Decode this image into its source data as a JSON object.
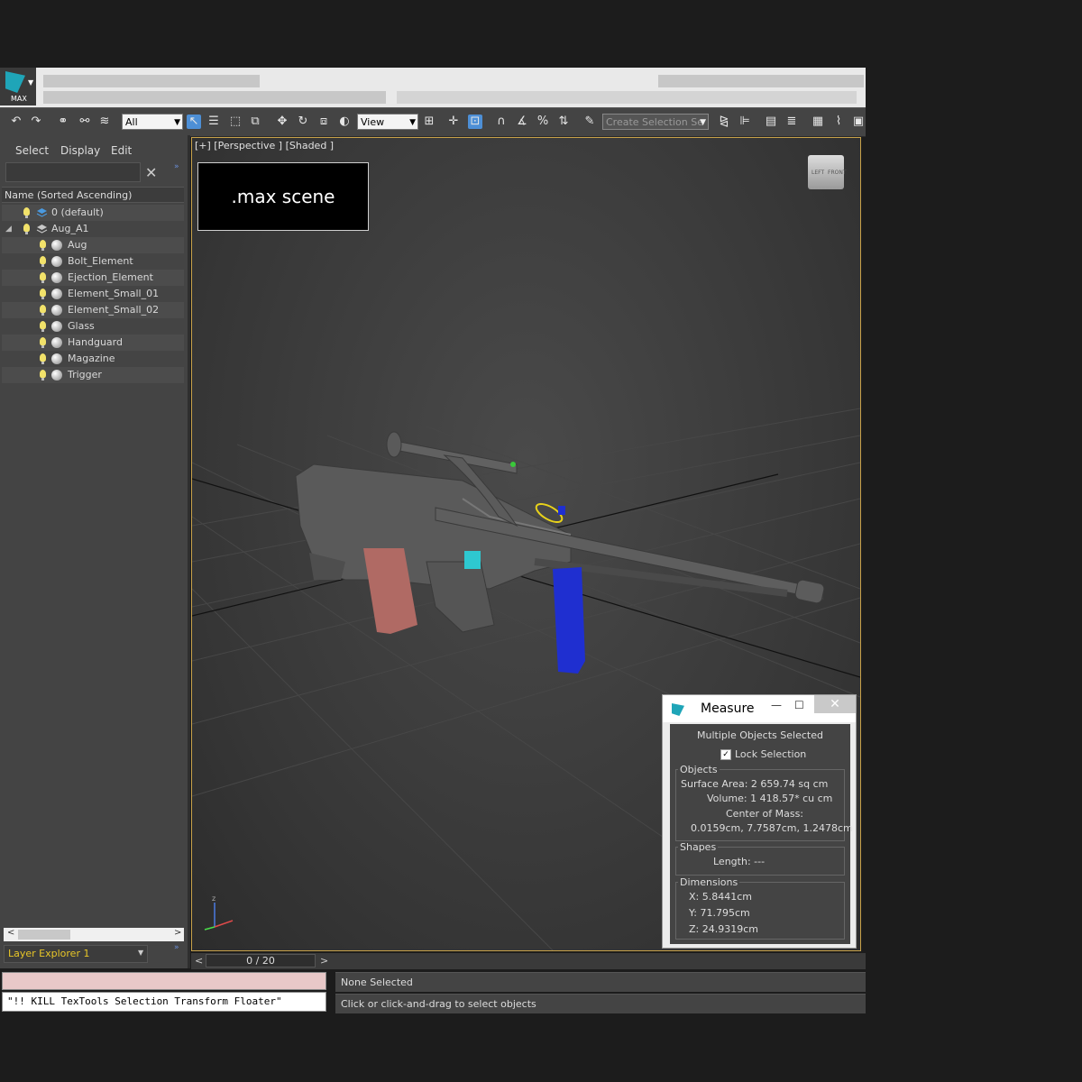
{
  "toolbar": {
    "selection_filter": "All",
    "reference_coord": "View",
    "named_selection_placeholder": "Create Selection Se"
  },
  "scene_explorer": {
    "menus": [
      "Select",
      "Display",
      "Edit"
    ],
    "column_header": "Name (Sorted Ascending)",
    "layers": [
      {
        "name": "0 (default)",
        "depth": 0
      },
      {
        "name": "Aug_A1",
        "depth": 0
      }
    ],
    "objects": [
      "Aug",
      "Bolt_Element",
      "Ejection_Element",
      "Element_Small_01",
      "Element_Small_02",
      "Glass",
      "Handguard",
      "Magazine",
      "Trigger"
    ],
    "explorer_name": "Layer Explorer 1"
  },
  "viewport": {
    "label": "[+] [Perspective ] [Shaded ]",
    "overlay_text": ".max scene",
    "viewcube_labels": [
      "LEFT",
      "FRONT"
    ]
  },
  "timeline": {
    "frame": "0 / 20"
  },
  "status": {
    "selection": "None Selected",
    "prompt": "Click or click-and-drag to select objects",
    "maxscript_line": "\"!! KILL TexTools Selection Transform Floater\""
  },
  "measure": {
    "title": "Measure",
    "selection_info": "Multiple Objects Selected",
    "lock_label": "Lock Selection",
    "objects_group": "Objects",
    "surface_area": "Surface Area:  2 659.74 sq cm",
    "volume": "Volume:  1 418.57* cu cm",
    "center_label": "Center of Mass:",
    "center_value": "0.0159cm, 7.7587cm, 1.2478cm",
    "shapes_group": "Shapes",
    "length": "Length:  ---",
    "dimensions_group": "Dimensions",
    "dim_x": "X:   5.8441cm",
    "dim_y": "Y:   71.795cm",
    "dim_z": "Z:   24.9319cm"
  },
  "colors": {
    "viewport_border": "#c8a24a",
    "magazine": "#b06a64",
    "handguard": "#1f2fd0",
    "trigger": "#2ec8d0",
    "selected_highlight": "#e8d21a"
  }
}
